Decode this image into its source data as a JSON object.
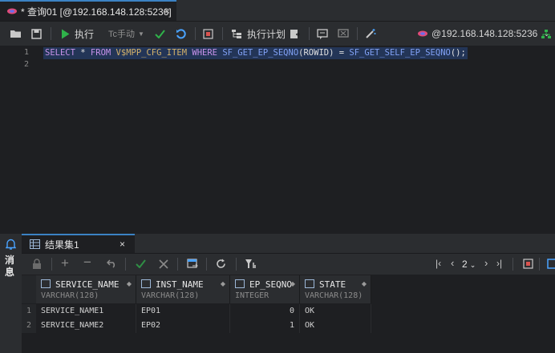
{
  "tab": {
    "title": "* 查询01 [@192.168.148.128:5236]",
    "close": "×"
  },
  "toolbar": {
    "execute_label": "执行",
    "tx_label": "Tc手动",
    "plan_label": "执行计划",
    "connection_label": "@192.168.148.128:5236"
  },
  "editor": {
    "lines": [
      "1",
      "2"
    ],
    "sql": {
      "kw_select": "SELECT",
      "star": "*",
      "kw_from": "FROM",
      "table": "V$MPP_CFG_ITEM",
      "kw_where": "WHERE",
      "fn1": "SF_GET_EP_SEQNO",
      "arg": "(ROWID)",
      "eq": "=",
      "fn2": "SF_GET_SELF_EP_SEQNO",
      "tail": "();"
    }
  },
  "sidebar": {
    "messages_label": "消息"
  },
  "results": {
    "tab_label": "结果集1",
    "tab_close": "×",
    "page": "2",
    "columns": [
      {
        "name": "SERVICE_NAME",
        "type": "VARCHAR(128)"
      },
      {
        "name": "INST_NAME",
        "type": "VARCHAR(128)"
      },
      {
        "name": "EP_SEQNO",
        "type": "INTEGER"
      },
      {
        "name": "STATE",
        "type": "VARCHAR(128)"
      }
    ],
    "rows": [
      {
        "num": "1",
        "cells": [
          "SERVICE_NAME1",
          "EP01",
          "0",
          "OK"
        ]
      },
      {
        "num": "2",
        "cells": [
          "SERVICE_NAME2",
          "EP02",
          "1",
          "OK"
        ]
      }
    ]
  },
  "colors": {
    "accent": "#3b82c4",
    "run_green": "#2fb34a",
    "selection": "#233557"
  }
}
